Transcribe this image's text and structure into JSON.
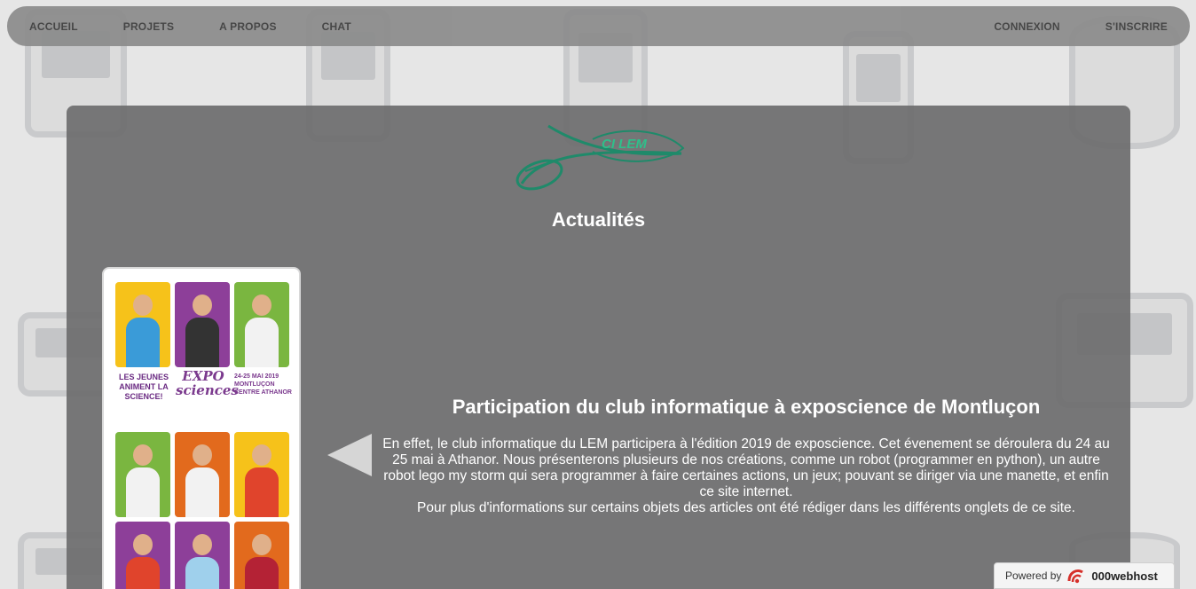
{
  "navbar": {
    "left": [
      "ACCUEIL",
      "PROJETS",
      "A PROPOS",
      "CHAT"
    ],
    "right": [
      "CONNEXION",
      "S'INSCRIRE"
    ]
  },
  "logo": {
    "text": "CI LEM"
  },
  "main": {
    "section_title": "Actualités",
    "poster": {
      "slogan": "LES JEUNES ANIMENT LA SCIENCE!",
      "brand": "EXPO sciences",
      "dates": "24-25 MAI 2019 MONTLUÇON CENTRE ATHANOR"
    },
    "article": {
      "title": "Participation du club informatique à exposcience de Montluçon",
      "body": "En effet, le club informatique du LEM participera à l'édition 2019 de exposcience. Cet évenement se déroulera du 24 au 25 mai à Athanor. Nous présenterons plusieurs de nos créations, comme un robot (programmer en python), un autre robot lego my storm qui sera programmer à faire certaines actions, un jeux; pouvant se diriger via une manette, et enfin ce site internet.",
      "note": "Pour plus d'informations sur certains objets des articles ont été rédiger dans les différents onglets de ce site."
    },
    "prev_icon": "arrow-left-icon"
  },
  "badge": {
    "powered": "Powered by",
    "host": "000webhost"
  },
  "colors": {
    "panel": "#6c6c6e",
    "navbar": "#8c8c8c",
    "logo_green": "#1f8a6a"
  }
}
